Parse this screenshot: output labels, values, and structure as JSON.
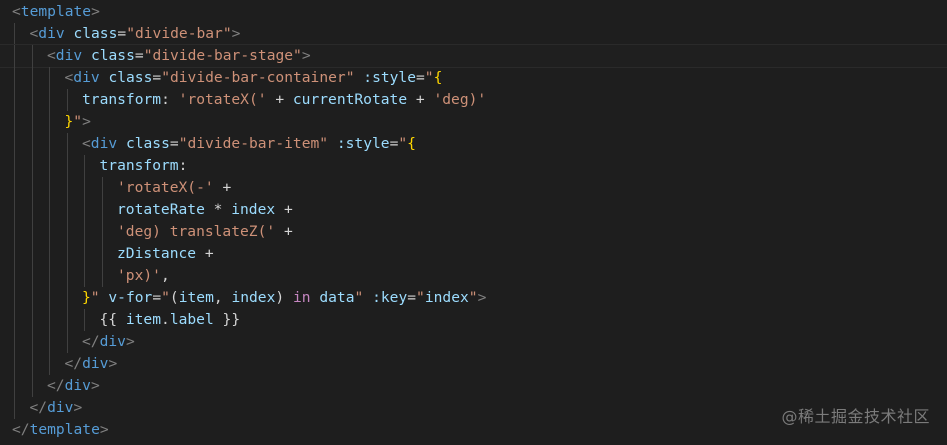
{
  "editor": {
    "colors": {
      "background": "#1e1e1e",
      "punctuation": "#808080",
      "tag": "#569cd6",
      "attribute": "#9cdcfe",
      "string": "#ce9178",
      "brace": "#ffd700",
      "plain": "#d4d4d4",
      "directive": "#c586c0"
    },
    "lines": [
      {
        "indent": 0,
        "highlight": false,
        "tokens": [
          [
            "punc",
            "<"
          ],
          [
            "tag",
            "template"
          ],
          [
            "punc",
            ">"
          ]
        ]
      },
      {
        "indent": 1,
        "highlight": false,
        "tokens": [
          [
            "punc",
            "<"
          ],
          [
            "tag",
            "div"
          ],
          [
            "plain",
            " "
          ],
          [
            "attr",
            "class"
          ],
          [
            "plain",
            "="
          ],
          [
            "str",
            "\"divide-bar\""
          ],
          [
            "punc",
            ">"
          ]
        ]
      },
      {
        "indent": 2,
        "highlight": true,
        "tokens": [
          [
            "punc",
            "<"
          ],
          [
            "tag",
            "div"
          ],
          [
            "plain",
            " "
          ],
          [
            "attr",
            "class"
          ],
          [
            "plain",
            "="
          ],
          [
            "str",
            "\"divide-bar-stage\""
          ],
          [
            "punc",
            ">"
          ]
        ]
      },
      {
        "indent": 3,
        "highlight": false,
        "tokens": [
          [
            "punc",
            "<"
          ],
          [
            "tag",
            "div"
          ],
          [
            "plain",
            " "
          ],
          [
            "attr",
            "class"
          ],
          [
            "plain",
            "="
          ],
          [
            "str",
            "\"divide-bar-container\""
          ],
          [
            "plain",
            " "
          ],
          [
            "attr",
            ":style"
          ],
          [
            "plain",
            "="
          ],
          [
            "str",
            "\""
          ],
          [
            "brace",
            "{"
          ]
        ]
      },
      {
        "indent": 4,
        "highlight": false,
        "tokens": [
          [
            "attr",
            "transform"
          ],
          [
            "plain",
            ": "
          ],
          [
            "str",
            "'rotateX('"
          ],
          [
            "plain",
            " + "
          ],
          [
            "attr",
            "currentRotate"
          ],
          [
            "plain",
            " + "
          ],
          [
            "str",
            "'deg)'"
          ]
        ]
      },
      {
        "indent": 3,
        "highlight": false,
        "tokens": [
          [
            "brace",
            "}"
          ],
          [
            "str",
            "\""
          ],
          [
            "punc",
            ">"
          ]
        ]
      },
      {
        "indent": 4,
        "highlight": false,
        "tokens": [
          [
            "punc",
            "<"
          ],
          [
            "tag",
            "div"
          ],
          [
            "plain",
            " "
          ],
          [
            "attr",
            "class"
          ],
          [
            "plain",
            "="
          ],
          [
            "str",
            "\"divide-bar-item\""
          ],
          [
            "plain",
            " "
          ],
          [
            "attr",
            ":style"
          ],
          [
            "plain",
            "="
          ],
          [
            "str",
            "\""
          ],
          [
            "brace",
            "{"
          ]
        ]
      },
      {
        "indent": 5,
        "highlight": false,
        "tokens": [
          [
            "attr",
            "transform"
          ],
          [
            "plain",
            ":"
          ]
        ]
      },
      {
        "indent": 6,
        "highlight": false,
        "tokens": [
          [
            "str",
            "'rotateX(-'"
          ],
          [
            "plain",
            " +"
          ]
        ]
      },
      {
        "indent": 6,
        "highlight": false,
        "tokens": [
          [
            "attr",
            "rotateRate"
          ],
          [
            "plain",
            " * "
          ],
          [
            "attr",
            "index"
          ],
          [
            "plain",
            " +"
          ]
        ]
      },
      {
        "indent": 6,
        "highlight": false,
        "tokens": [
          [
            "str",
            "'deg) translateZ('"
          ],
          [
            "plain",
            " +"
          ]
        ]
      },
      {
        "indent": 6,
        "highlight": false,
        "tokens": [
          [
            "attr",
            "zDistance"
          ],
          [
            "plain",
            " +"
          ]
        ]
      },
      {
        "indent": 6,
        "highlight": false,
        "tokens": [
          [
            "str",
            "'px)'"
          ],
          [
            "plain",
            ","
          ]
        ]
      },
      {
        "indent": 4,
        "highlight": false,
        "tokens": [
          [
            "brace",
            "}"
          ],
          [
            "str",
            "\""
          ],
          [
            "plain",
            " "
          ],
          [
            "attr",
            "v-for"
          ],
          [
            "plain",
            "="
          ],
          [
            "str",
            "\""
          ],
          [
            "plain",
            "("
          ],
          [
            "attr",
            "item"
          ],
          [
            "plain",
            ", "
          ],
          [
            "attr",
            "index"
          ],
          [
            "plain",
            ") "
          ],
          [
            "dir",
            "in"
          ],
          [
            "plain",
            " "
          ],
          [
            "attr",
            "data"
          ],
          [
            "str",
            "\""
          ],
          [
            "plain",
            " "
          ],
          [
            "attr",
            ":key"
          ],
          [
            "plain",
            "="
          ],
          [
            "str",
            "\""
          ],
          [
            "attr",
            "index"
          ],
          [
            "str",
            "\""
          ],
          [
            "punc",
            ">"
          ]
        ]
      },
      {
        "indent": 5,
        "highlight": false,
        "tokens": [
          [
            "plain",
            "{{ "
          ],
          [
            "attr",
            "item"
          ],
          [
            "plain",
            "."
          ],
          [
            "attr",
            "label"
          ],
          [
            "plain",
            " }}"
          ]
        ]
      },
      {
        "indent": 4,
        "highlight": false,
        "tokens": [
          [
            "punc",
            "</"
          ],
          [
            "tag",
            "div"
          ],
          [
            "punc",
            ">"
          ]
        ]
      },
      {
        "indent": 3,
        "highlight": false,
        "tokens": [
          [
            "punc",
            "</"
          ],
          [
            "tag",
            "div"
          ],
          [
            "punc",
            ">"
          ]
        ]
      },
      {
        "indent": 2,
        "highlight": false,
        "tokens": [
          [
            "punc",
            "</"
          ],
          [
            "tag",
            "div"
          ],
          [
            "punc",
            ">"
          ]
        ]
      },
      {
        "indent": 1,
        "highlight": false,
        "tokens": [
          [
            "punc",
            "</"
          ],
          [
            "tag",
            "div"
          ],
          [
            "punc",
            ">"
          ]
        ]
      },
      {
        "indent": 0,
        "highlight": false,
        "tokens": [
          [
            "punc",
            "</"
          ],
          [
            "tag",
            "template"
          ],
          [
            "punc",
            ">"
          ]
        ]
      }
    ]
  },
  "watermark": "@稀土掘金技术社区"
}
